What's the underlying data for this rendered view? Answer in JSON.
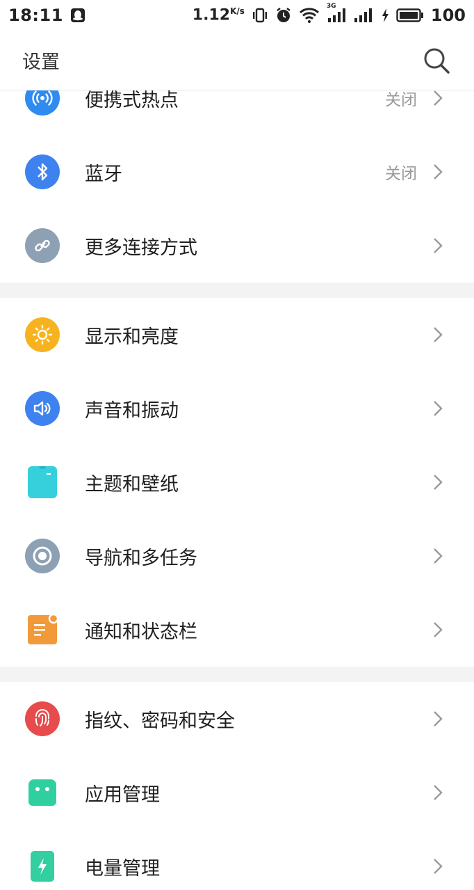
{
  "status_bar": {
    "time": "18:11",
    "speed": "1.12",
    "speed_unit": "K/s",
    "network": "3G",
    "battery": "100"
  },
  "header": {
    "title": "设置",
    "search_icon": "search-icon"
  },
  "groups": [
    {
      "items": [
        {
          "label": "便携式热点",
          "value": "关闭",
          "icon": "hotspot-icon",
          "color": "#2F8BF0"
        },
        {
          "label": "蓝牙",
          "value": "关闭",
          "icon": "bluetooth-icon",
          "color": "#3D82EE"
        },
        {
          "label": "更多连接方式",
          "value": "",
          "icon": "link-icon",
          "color": "#8EA0B3"
        }
      ]
    },
    {
      "items": [
        {
          "label": "显示和亮度",
          "value": "",
          "icon": "brightness-icon",
          "color": "#F7B31F"
        },
        {
          "label": "声音和振动",
          "value": "",
          "icon": "speaker-icon",
          "color": "#3D82EE"
        },
        {
          "label": "主题和壁纸",
          "value": "",
          "icon": "theme-shirt-icon",
          "color": "#35D0DC"
        },
        {
          "label": "导航和多任务",
          "value": "",
          "icon": "navigation-icon",
          "color": "#8EA0B3"
        },
        {
          "label": "通知和状态栏",
          "value": "",
          "icon": "notification-icon",
          "color": "#F29A3A"
        }
      ]
    },
    {
      "items": [
        {
          "label": "指纹、密码和安全",
          "value": "",
          "icon": "fingerprint-icon",
          "color": "#E84B4B"
        },
        {
          "label": "应用管理",
          "value": "",
          "icon": "android-icon",
          "color": "#2FCFA0"
        },
        {
          "label": "电量管理",
          "value": "",
          "icon": "battery-charge-icon",
          "color": "#33CFA0"
        }
      ]
    }
  ]
}
